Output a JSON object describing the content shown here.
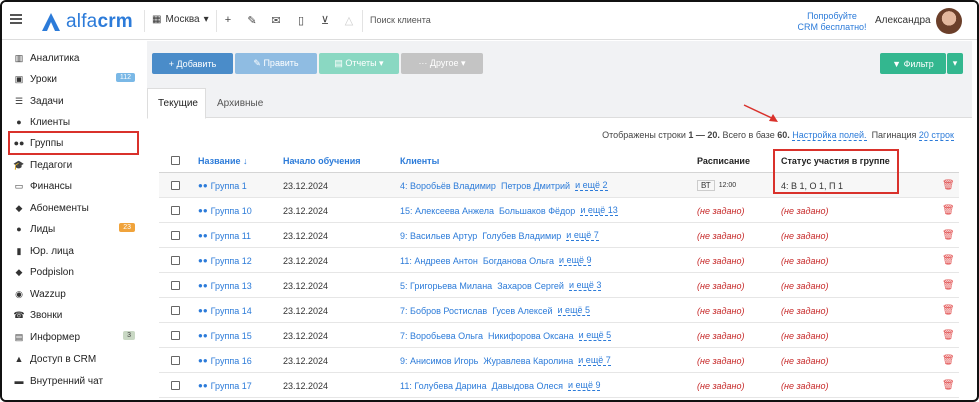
{
  "topbar": {
    "branch": "Москва",
    "search_placeholder": "Поиск клиента",
    "promo_line1": "Попробуйте",
    "promo_line2": "CRM бесплатно!",
    "user_name": "Александра"
  },
  "logo": {
    "prefix": "alfa",
    "suffix": "crm"
  },
  "sidebar": {
    "items": [
      {
        "label": "Аналитика",
        "icon": "analytics-icon",
        "glyph": "▥"
      },
      {
        "label": "Уроки",
        "icon": "lessons-icon",
        "glyph": "▣",
        "badge": "112",
        "badge_color": "#7ab8e6"
      },
      {
        "label": "Задачи",
        "icon": "tasks-icon",
        "glyph": "☰"
      },
      {
        "label": "Клиенты",
        "icon": "user-icon",
        "glyph": "●"
      },
      {
        "label": "Группы",
        "icon": "group-icon",
        "glyph": "●●"
      },
      {
        "label": "Педагоги",
        "icon": "teacher-icon",
        "glyph": "🎓"
      },
      {
        "label": "Финансы",
        "icon": "finance-icon",
        "glyph": "▭"
      },
      {
        "label": "Абонементы",
        "icon": "tag-icon",
        "glyph": "◆"
      },
      {
        "label": "Лиды",
        "icon": "leads-icon",
        "glyph": "●"
      },
      {
        "label": "Юр. лица",
        "icon": "legal-icon",
        "glyph": "▮"
      },
      {
        "label": "Podpislon",
        "icon": "pen-icon",
        "glyph": "◆"
      },
      {
        "label": "Wazzup",
        "icon": "chat-icon",
        "glyph": "◉"
      },
      {
        "label": "Звонки",
        "icon": "phone-icon",
        "glyph": "☎"
      },
      {
        "label": "Информер",
        "icon": "informer-icon",
        "glyph": "▤"
      },
      {
        "label": "Доступ в CRM",
        "icon": "lock-icon",
        "glyph": "▲"
      },
      {
        "label": "Внутренний чат",
        "icon": "message-icon",
        "glyph": "▬"
      }
    ],
    "badges": {
      "lessons": "112",
      "leads": "23",
      "informer": "3"
    },
    "active": "Группы"
  },
  "toolbar": {
    "add_label": "+ Добавить",
    "edit_label": "✎ Править",
    "reports_label": "▤ Отчеты ▾",
    "other_label": "··· Другое ▾",
    "filter_label": "▼ Фильтр",
    "filter_caret": "▾"
  },
  "tabs": {
    "current": "Текущие",
    "archive": "Архивные"
  },
  "info": {
    "shown_prefix": "Отображены строки",
    "shown_range": "1 — 20.",
    "total_prefix": "Всего в базе",
    "total_value": "60.",
    "settings_link": "Настройка полей.",
    "pagination_prefix": "Пагинация",
    "pagination_link": "20 строк"
  },
  "columns": {
    "name": "Название ↓",
    "start": "Начало обучения",
    "clients": "Клиенты",
    "schedule": "Расписание",
    "status": "Статус участия в группе"
  },
  "rows": [
    {
      "name": "Группа 1",
      "date": "23.12.2024",
      "count": "4:",
      "c1": "Воробьёв Владимир",
      "c2": "Петров Дмитрий",
      "more": "и ещё 2",
      "sched_day": "ВТ",
      "sched_time": "12:00",
      "status": "4:  В 1, О 1, П 1"
    },
    {
      "name": "Группа 10",
      "date": "23.12.2024",
      "count": "15:",
      "c1": "Алексеева Анжела",
      "c2": "Большаков Фёдор",
      "more": "и ещё 13",
      "sched": "(не задано)",
      "status_notset": "(не задано)"
    },
    {
      "name": "Группа 11",
      "date": "23.12.2024",
      "count": "9:",
      "c1": "Васильев Артур",
      "c2": "Голубев Владимир",
      "more": "и ещё 7",
      "sched": "(не задано)",
      "status_notset": "(не задано)"
    },
    {
      "name": "Группа 12",
      "date": "23.12.2024",
      "count": "11:",
      "c1": "Андреев Антон",
      "c2": "Богданова Ольга",
      "more": "и ещё 9",
      "sched": "(не задано)",
      "status_notset": "(не задано)"
    },
    {
      "name": "Группа 13",
      "date": "23.12.2024",
      "count": "5:",
      "c1": "Григорьева Милана",
      "c2": "Захаров Сергей",
      "more": "и ещё 3",
      "sched": "(не задано)",
      "status_notset": "(не задано)"
    },
    {
      "name": "Группа 14",
      "date": "23.12.2024",
      "count": "7:",
      "c1": "Бобров Ростислав",
      "c2": "Гусев Алексей",
      "more": "и ещё 5",
      "sched": "(не задано)",
      "status_notset": "(не задано)"
    },
    {
      "name": "Группа 15",
      "date": "23.12.2024",
      "count": "7:",
      "c1": "Воробьева Ольга",
      "c2": "Никифорова Оксана",
      "more": "и ещё 5",
      "sched": "(не задано)",
      "status_notset": "(не задано)"
    },
    {
      "name": "Группа 16",
      "date": "23.12.2024",
      "count": "9:",
      "c1": "Анисимов Игорь",
      "c2": "Журавлева Каролина",
      "more": "и ещё 7",
      "sched": "(не задано)",
      "status_notset": "(не задано)"
    },
    {
      "name": "Группа 17",
      "date": "23.12.2024",
      "count": "11:",
      "c1": "Голубева Дарина",
      "c2": "Давыдова Олеся",
      "more": "и ещё 9",
      "sched": "(не задано)",
      "status_notset": "(не задано)"
    }
  ],
  "colors": {
    "accent": "#2c7bd9",
    "highlight": "#d9312b",
    "filter": "#33b78f",
    "notset": "#c62828"
  }
}
